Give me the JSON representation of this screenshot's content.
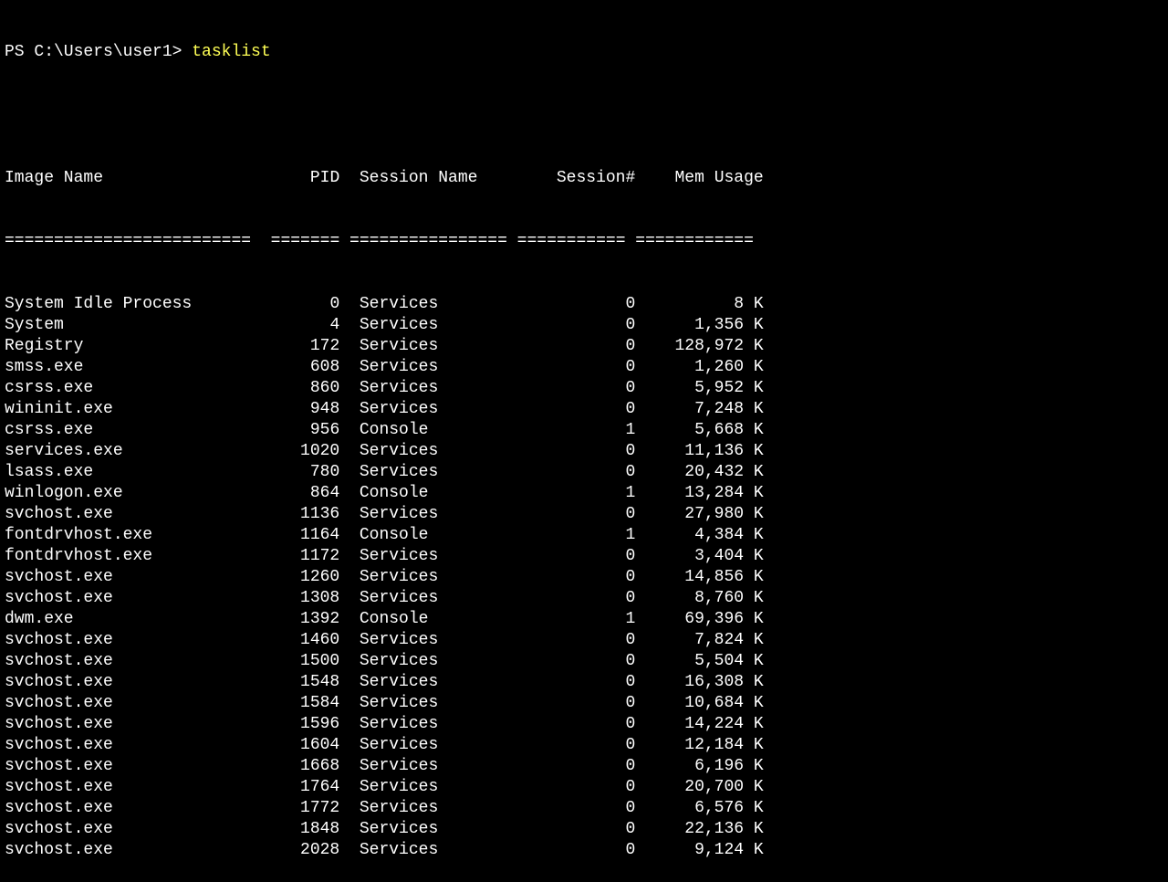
{
  "prompt": "PS C:\\Users\\user1> ",
  "command": "tasklist",
  "columns": {
    "image_name": "Image Name",
    "pid": "PID",
    "session_name": "Session Name",
    "session_num": "Session#",
    "mem_usage": "Mem Usage"
  },
  "dividers": {
    "image_name": "=========================",
    "pid": "========",
    "session_name": "================",
    "session_num": "===========",
    "mem_usage": "============"
  },
  "rows": [
    {
      "image_name": "System Idle Process",
      "pid": "0",
      "session_name": "Services",
      "session_num": "0",
      "mem_usage": "8 K"
    },
    {
      "image_name": "System",
      "pid": "4",
      "session_name": "Services",
      "session_num": "0",
      "mem_usage": "1,356 K"
    },
    {
      "image_name": "Registry",
      "pid": "172",
      "session_name": "Services",
      "session_num": "0",
      "mem_usage": "128,972 K"
    },
    {
      "image_name": "smss.exe",
      "pid": "608",
      "session_name": "Services",
      "session_num": "0",
      "mem_usage": "1,260 K"
    },
    {
      "image_name": "csrss.exe",
      "pid": "860",
      "session_name": "Services",
      "session_num": "0",
      "mem_usage": "5,952 K"
    },
    {
      "image_name": "wininit.exe",
      "pid": "948",
      "session_name": "Services",
      "session_num": "0",
      "mem_usage": "7,248 K"
    },
    {
      "image_name": "csrss.exe",
      "pid": "956",
      "session_name": "Console",
      "session_num": "1",
      "mem_usage": "5,668 K"
    },
    {
      "image_name": "services.exe",
      "pid": "1020",
      "session_name": "Services",
      "session_num": "0",
      "mem_usage": "11,136 K"
    },
    {
      "image_name": "lsass.exe",
      "pid": "780",
      "session_name": "Services",
      "session_num": "0",
      "mem_usage": "20,432 K"
    },
    {
      "image_name": "winlogon.exe",
      "pid": "864",
      "session_name": "Console",
      "session_num": "1",
      "mem_usage": "13,284 K"
    },
    {
      "image_name": "svchost.exe",
      "pid": "1136",
      "session_name": "Services",
      "session_num": "0",
      "mem_usage": "27,980 K"
    },
    {
      "image_name": "fontdrvhost.exe",
      "pid": "1164",
      "session_name": "Console",
      "session_num": "1",
      "mem_usage": "4,384 K"
    },
    {
      "image_name": "fontdrvhost.exe",
      "pid": "1172",
      "session_name": "Services",
      "session_num": "0",
      "mem_usage": "3,404 K"
    },
    {
      "image_name": "svchost.exe",
      "pid": "1260",
      "session_name": "Services",
      "session_num": "0",
      "mem_usage": "14,856 K"
    },
    {
      "image_name": "svchost.exe",
      "pid": "1308",
      "session_name": "Services",
      "session_num": "0",
      "mem_usage": "8,760 K"
    },
    {
      "image_name": "dwm.exe",
      "pid": "1392",
      "session_name": "Console",
      "session_num": "1",
      "mem_usage": "69,396 K"
    },
    {
      "image_name": "svchost.exe",
      "pid": "1460",
      "session_name": "Services",
      "session_num": "0",
      "mem_usage": "7,824 K"
    },
    {
      "image_name": "svchost.exe",
      "pid": "1500",
      "session_name": "Services",
      "session_num": "0",
      "mem_usage": "5,504 K"
    },
    {
      "image_name": "svchost.exe",
      "pid": "1548",
      "session_name": "Services",
      "session_num": "0",
      "mem_usage": "16,308 K"
    },
    {
      "image_name": "svchost.exe",
      "pid": "1584",
      "session_name": "Services",
      "session_num": "0",
      "mem_usage": "10,684 K"
    },
    {
      "image_name": "svchost.exe",
      "pid": "1596",
      "session_name": "Services",
      "session_num": "0",
      "mem_usage": "14,224 K"
    },
    {
      "image_name": "svchost.exe",
      "pid": "1604",
      "session_name": "Services",
      "session_num": "0",
      "mem_usage": "12,184 K"
    },
    {
      "image_name": "svchost.exe",
      "pid": "1668",
      "session_name": "Services",
      "session_num": "0",
      "mem_usage": "6,196 K"
    },
    {
      "image_name": "svchost.exe",
      "pid": "1764",
      "session_name": "Services",
      "session_num": "0",
      "mem_usage": "20,700 K"
    },
    {
      "image_name": "svchost.exe",
      "pid": "1772",
      "session_name": "Services",
      "session_num": "0",
      "mem_usage": "6,576 K"
    },
    {
      "image_name": "svchost.exe",
      "pid": "1848",
      "session_name": "Services",
      "session_num": "0",
      "mem_usage": "22,136 K"
    },
    {
      "image_name": "svchost.exe",
      "pid": "2028",
      "session_name": "Services",
      "session_num": "0",
      "mem_usage": "9,124 K"
    }
  ]
}
